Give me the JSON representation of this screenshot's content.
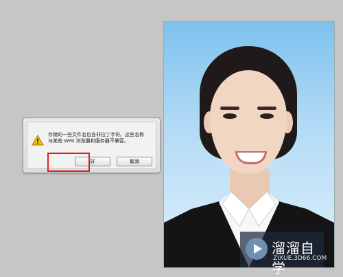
{
  "dialog": {
    "message_line1": "存储的一些文件名包含非拉丁字符。这些名称",
    "message_line2": "与某些 Web 浏览器和服务器不兼容。",
    "ok_label": "好",
    "cancel_label": "取消"
  },
  "watermark": {
    "title": "溜溜自学",
    "subtitle": "ZIXUE.3D66.COM"
  },
  "colors": {
    "highlight": "#e41c1c",
    "warning": "#f2c200"
  }
}
